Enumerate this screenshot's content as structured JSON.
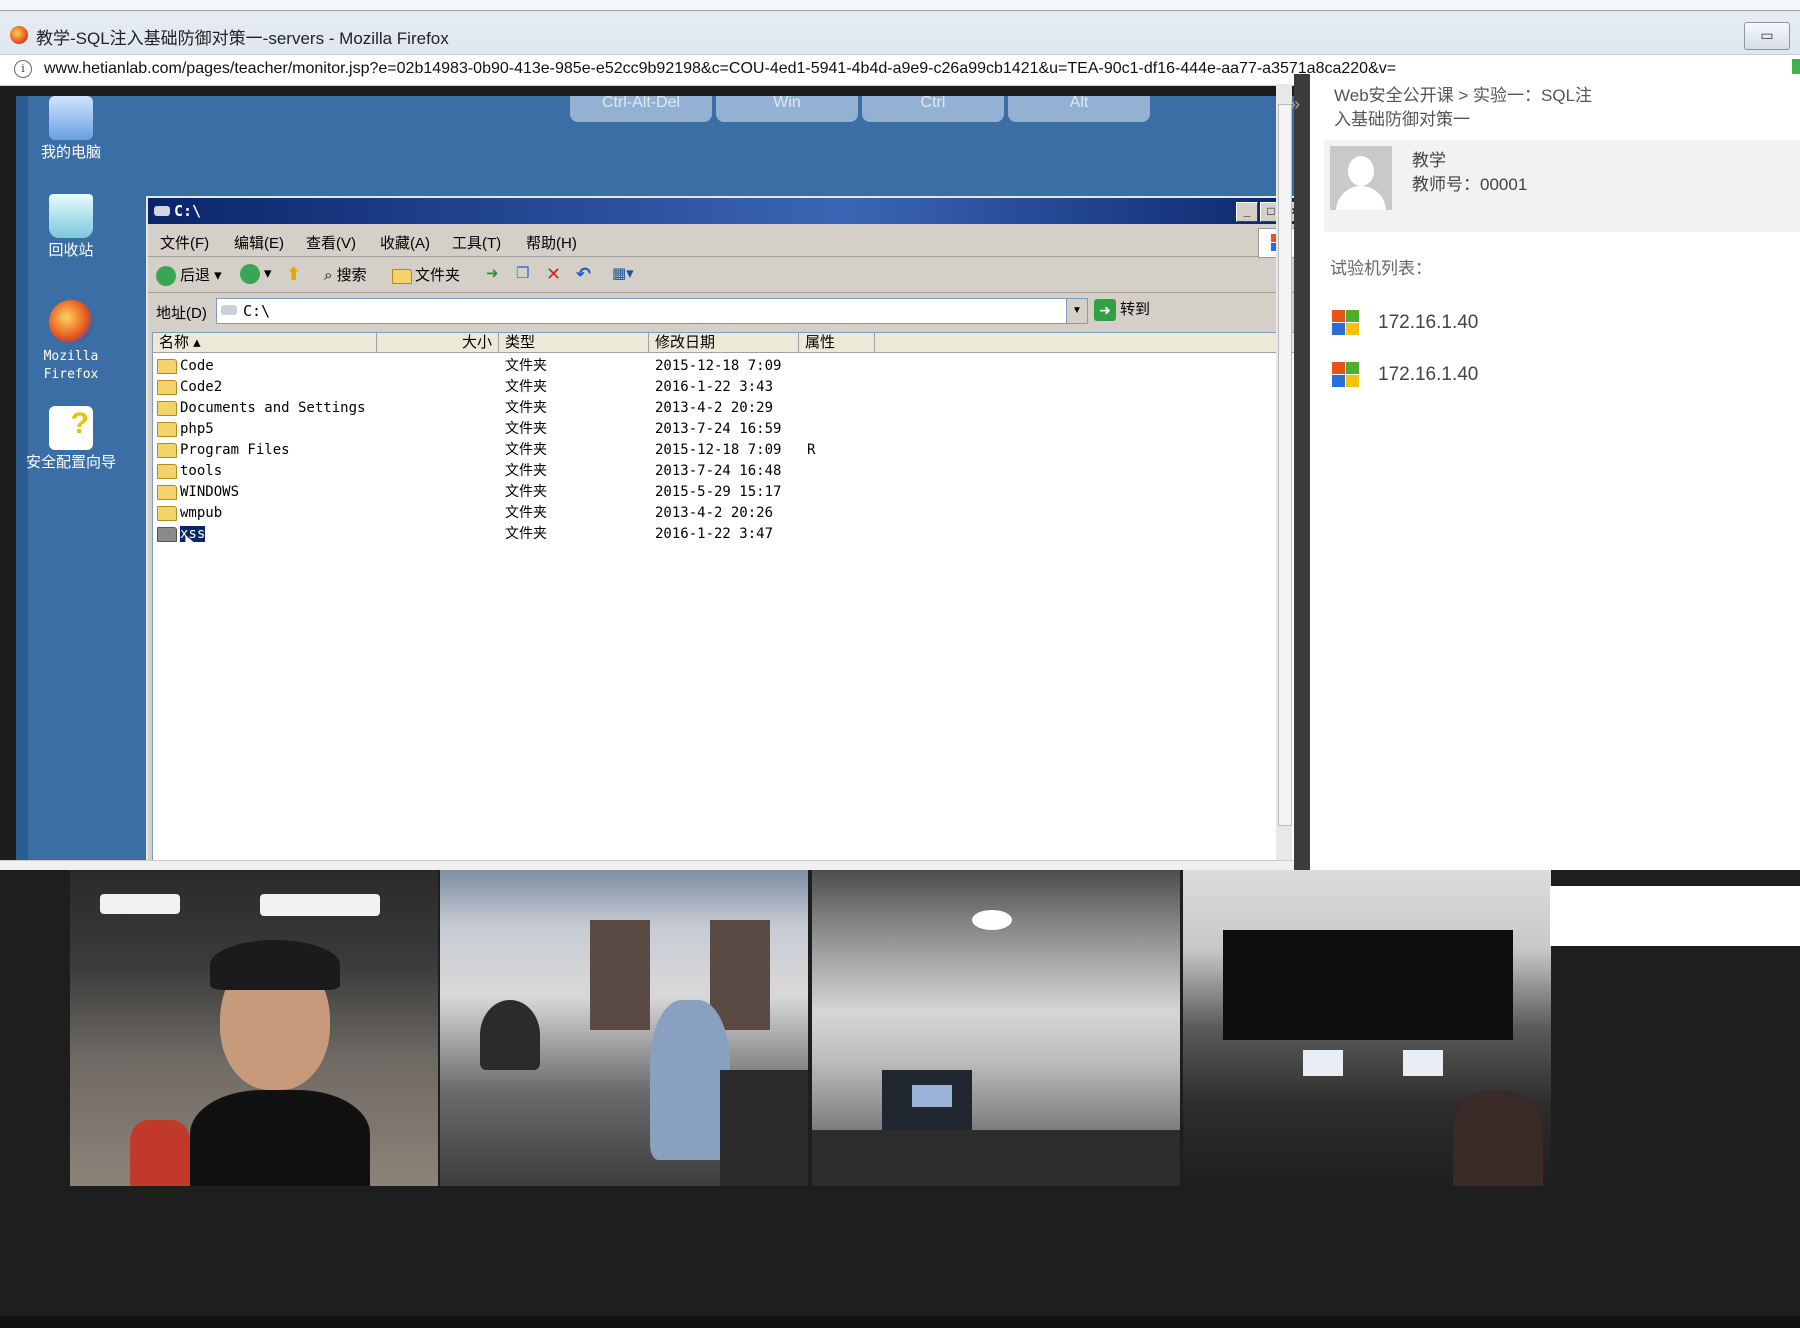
{
  "browser": {
    "title": "教学-SQL注入基础防御对策一-servers - Mozilla Firefox",
    "url": "www.hetianlab.com/pages/teacher/monitor.jsp?e=02b14983-0b90-413e-985e-e52cc9b92198&c=COU-4ed1-5941-4b4d-a9e9-c26a99cb1421&u=TEA-90c1-df16-444e-aa77-a3571a8ca220&v=",
    "restore_label": "▭"
  },
  "remote_buttons": [
    "Ctrl-Alt-Del",
    "Win",
    "Ctrl",
    "Alt"
  ],
  "desktop_icons": [
    {
      "label": "我的电脑",
      "icon": "my-computer-icon"
    },
    {
      "label": "回收站",
      "icon": "recycle-bin-icon"
    },
    {
      "label": "Mozilla Firefox",
      "icon": "firefox-icon"
    },
    {
      "label": "安全配置向导",
      "icon": "security-wizard-icon"
    }
  ],
  "explorer": {
    "title": "C:\\",
    "menu": [
      "文件(F)",
      "编辑(E)",
      "查看(V)",
      "收藏(A)",
      "工具(T)",
      "帮助(H)"
    ],
    "toolbar": {
      "back": "后退",
      "search": "搜索",
      "folders": "文件夹"
    },
    "address_label": "地址(D)",
    "address_value": "C:\\",
    "goto_label": "转到",
    "columns": [
      "名称",
      "大小",
      "类型",
      "修改日期",
      "属性"
    ],
    "files": [
      {
        "name": "Code",
        "type": "文件夹",
        "date": "2015-12-18 7:09",
        "attr": ""
      },
      {
        "name": "Code2",
        "type": "文件夹",
        "date": "2016-1-22 3:43",
        "attr": ""
      },
      {
        "name": "Documents and Settings",
        "type": "文件夹",
        "date": "2013-4-2 20:29",
        "attr": ""
      },
      {
        "name": "php5",
        "type": "文件夹",
        "date": "2013-7-24 16:59",
        "attr": ""
      },
      {
        "name": "Program Files",
        "type": "文件夹",
        "date": "2015-12-18 7:09",
        "attr": "R"
      },
      {
        "name": "tools",
        "type": "文件夹",
        "date": "2013-7-24 16:48",
        "attr": ""
      },
      {
        "name": "WINDOWS",
        "type": "文件夹",
        "date": "2015-5-29 15:17",
        "attr": ""
      },
      {
        "name": "wmpub",
        "type": "文件夹",
        "date": "2013-4-2 20:26",
        "attr": ""
      },
      {
        "name": "xss",
        "type": "文件夹",
        "date": "2016-1-22 3:47",
        "attr": "",
        "selected": true
      }
    ]
  },
  "sidebar": {
    "breadcrumb": "Web安全公开课 > 实验一：SQL注入基础防御对策一",
    "teacher_name": "教学",
    "teacher_id": "教师号：00001",
    "vm_list_title": "试验机列表：",
    "vms": [
      "172.16.1.40",
      "172.16.1.40"
    ]
  },
  "colors": {
    "desktop_blue": "#3a6ea5",
    "titlebar_navy": "#0a246a",
    "sidebar_bg": "#ffffff"
  }
}
